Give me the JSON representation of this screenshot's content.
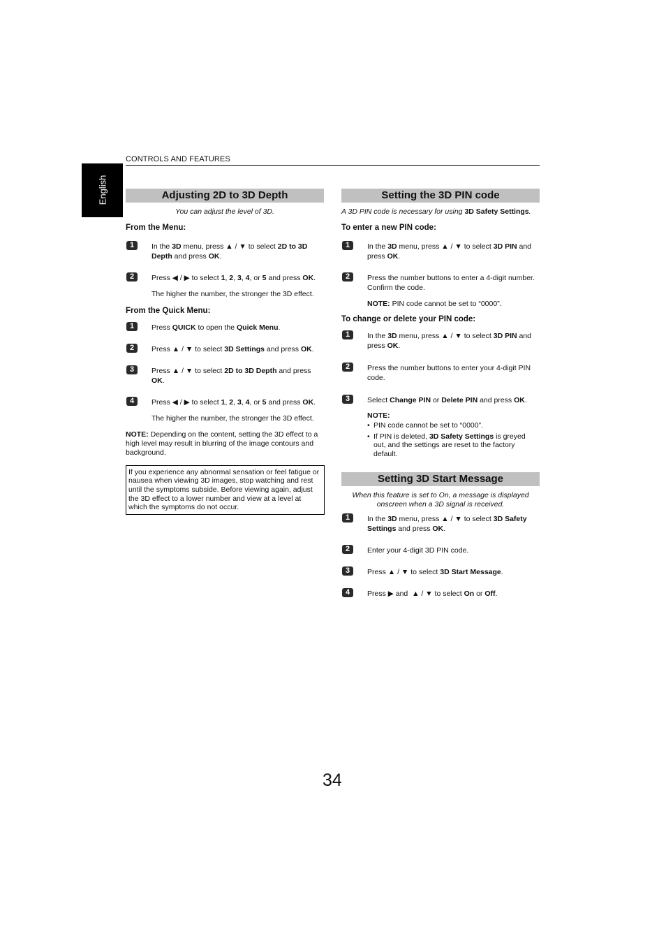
{
  "header": {
    "section": "CONTROLS AND FEATURES",
    "language_tab": "English"
  },
  "left": {
    "title": "Adjusting 2D to 3D Depth",
    "intro": "You can adjust the level of 3D.",
    "from_menu": {
      "heading": "From the Menu:",
      "steps": [
        {
          "num": "1",
          "html": "In the <b>3D</b> menu, press ▲ / ▼ to select <b>2D to 3D Depth</b> and press <b>OK</b>."
        },
        {
          "num": "2",
          "html": "Press ◀ / ▶ to select <b>1</b>, <b>2</b>, <b>3</b>, <b>4</b>, or <b>5</b> and press <b>OK</b>."
        }
      ],
      "after": "The higher the number, the stronger the 3D effect."
    },
    "from_quick": {
      "heading": "From the Quick Menu:",
      "steps": [
        {
          "num": "1",
          "html": "Press <b>QUICK</b> to open the <b>Quick Menu</b>."
        },
        {
          "num": "2",
          "html": "Press ▲ / ▼ to select <b>3D Settings</b> and press <b>OK</b>."
        },
        {
          "num": "3",
          "html": "Press ▲ / ▼ to select <b>2D to 3D Depth</b> and press <b>OK</b>."
        },
        {
          "num": "4",
          "html": "Press ◀ / ▶ to select <b>1</b>, <b>2</b>, <b>3</b>, <b>4</b>, or <b>5</b> and press <b>OK</b>."
        }
      ],
      "after": "The higher the number, the stronger the 3D effect."
    },
    "note_label": "NOTE:",
    "note": "Depending on the content, setting the 3D effect to a high level may result in blurring of the image contours and background.",
    "warning": "If you experience any abnormal sensation or feel fatigue or nausea when viewing 3D images, stop watching and rest until the symptoms subside. Before viewing again, adjust the 3D effect to a lower number and view at a level at which the symptoms do not occur."
  },
  "right": {
    "pin": {
      "title": "Setting the 3D PIN code",
      "intro_html": "A 3D PIN code is necessary for using <b>3D Safety Settings</b>.",
      "new_heading": "To enter a new PIN code:",
      "new_steps": [
        {
          "num": "1",
          "html": "In the <b>3D</b> menu, press ▲ / ▼ to select <b>3D PIN</b> and press <b>OK</b>."
        },
        {
          "num": "2",
          "html": "Press the number buttons to enter a 4-digit number. Confirm the code."
        }
      ],
      "new_note_label": "NOTE:",
      "new_note": "PIN code cannot be set to “0000”.",
      "change_heading": "To change or delete your PIN code:",
      "change_steps": [
        {
          "num": "1",
          "html": "In the <b>3D</b> menu, press ▲ / ▼ to select <b>3D PIN</b> and press <b>OK</b>."
        },
        {
          "num": "2",
          "html": "Press the number buttons to enter your 4-digit PIN code."
        },
        {
          "num": "3",
          "html": "Select <b>Change PIN</b> or <b>Delete PIN</b> and press <b>OK</b>."
        }
      ],
      "change_note_label": "NOTE:",
      "change_notes": [
        "PIN code cannot be set to “0000”.",
        "If PIN is deleted, <b>3D Safety Settings</b> is greyed out, and the settings are reset to the factory default."
      ]
    },
    "start": {
      "title": "Setting 3D Start Message",
      "intro": "When this feature is set to On, a message is displayed onscreen when a 3D signal is received.",
      "steps": [
        {
          "num": "1",
          "html": "In the <b>3D</b> menu, press ▲ / ▼ to select <b>3D Safety Settings</b> and press <b>OK</b>."
        },
        {
          "num": "2",
          "html": "Enter your 4-digit 3D PIN code."
        },
        {
          "num": "3",
          "html": "Press ▲ / ▼ to select <b>3D Start Message</b>."
        },
        {
          "num": "4",
          "html": "Press ▶ and &nbsp;▲ / ▼ to select <b>On</b> or <b>Off</b>."
        }
      ]
    }
  },
  "footer": {
    "page_number": "34"
  }
}
